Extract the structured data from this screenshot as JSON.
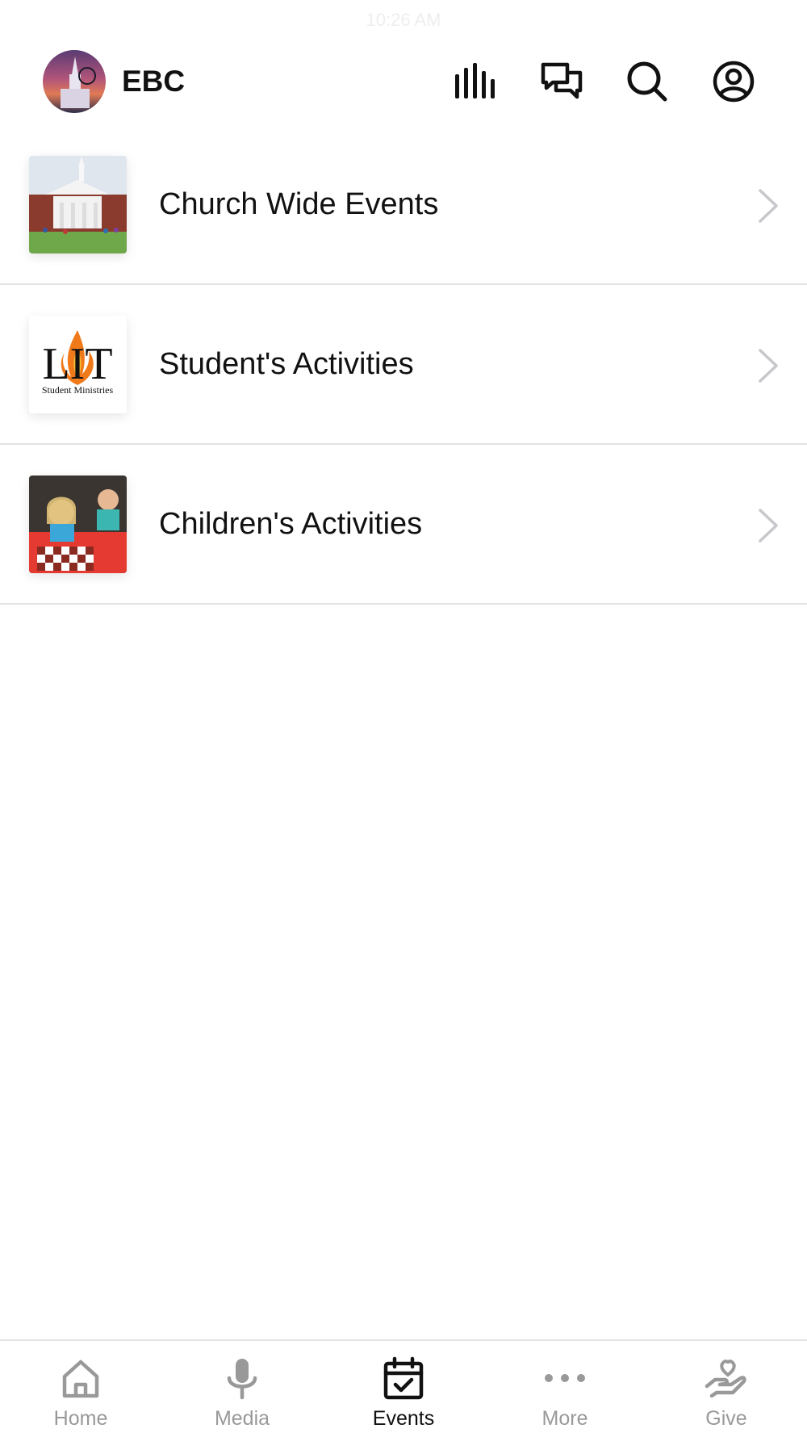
{
  "status_bar": {
    "time": "10:26 AM"
  },
  "header": {
    "app_name": "EBC",
    "icons": [
      "equalizer-icon",
      "chat-icon",
      "search-icon",
      "profile-icon"
    ]
  },
  "list": {
    "items": [
      {
        "label": "Church Wide Events",
        "thumb": "church-building"
      },
      {
        "label": "Student's Activities",
        "thumb": "lit-logo",
        "thumb_text": "LIT",
        "thumb_subtext": "Student Ministries"
      },
      {
        "label": "Children's Activities",
        "thumb": "children-checkers"
      }
    ]
  },
  "tabbar": {
    "tabs": [
      {
        "label": "Home",
        "icon": "home-icon",
        "active": false
      },
      {
        "label": "Media",
        "icon": "microphone-icon",
        "active": false
      },
      {
        "label": "Events",
        "icon": "calendar-check-icon",
        "active": true
      },
      {
        "label": "More",
        "icon": "more-dots-icon",
        "active": false
      },
      {
        "label": "Give",
        "icon": "heart-hand-icon",
        "active": false
      }
    ]
  },
  "colors": {
    "active": "#111111",
    "inactive": "#999999",
    "divider": "#e3e3e3",
    "chevron": "#c7c7cc"
  }
}
